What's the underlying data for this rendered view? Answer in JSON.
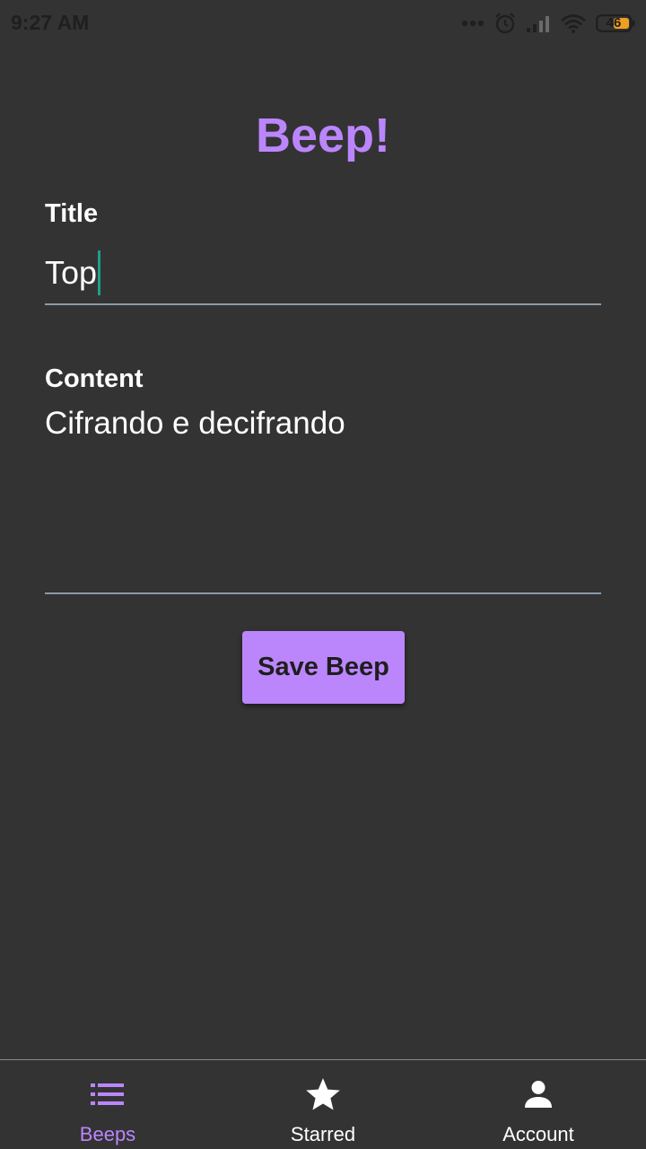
{
  "status_bar": {
    "time": "9:27 AM",
    "battery_level": "46"
  },
  "header": {
    "title": "Beep!"
  },
  "form": {
    "title_label": "Title",
    "title_value": "Top",
    "content_label": "Content",
    "content_value": "Cifrando e decifrando",
    "save_label": "Save Beep"
  },
  "bottom_nav": {
    "items": [
      {
        "label": "Beeps",
        "icon": "list-icon",
        "active": true
      },
      {
        "label": "Starred",
        "icon": "star-icon",
        "active": false
      },
      {
        "label": "Account",
        "icon": "person-icon",
        "active": false
      }
    ]
  },
  "colors": {
    "background": "#333333",
    "accent": "#bb86fc",
    "underline": "#8a9aa8",
    "caret": "#1e9e8a"
  }
}
